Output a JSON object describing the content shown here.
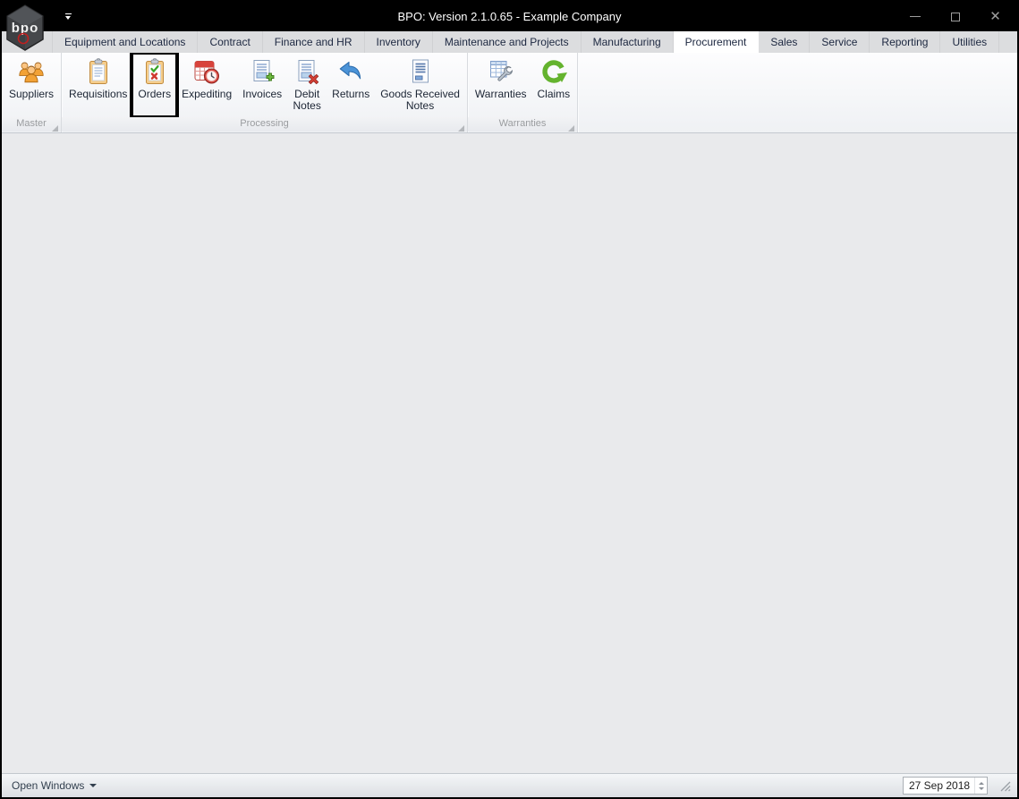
{
  "window": {
    "title": "BPO: Version 2.1.0.65 - Example Company",
    "logo_text": "bpo"
  },
  "tabs": [
    {
      "label": "Equipment and Locations",
      "active": false
    },
    {
      "label": "Contract",
      "active": false
    },
    {
      "label": "Finance and HR",
      "active": false
    },
    {
      "label": "Inventory",
      "active": false
    },
    {
      "label": "Maintenance and Projects",
      "active": false
    },
    {
      "label": "Manufacturing",
      "active": false
    },
    {
      "label": "Procurement",
      "active": true
    },
    {
      "label": "Sales",
      "active": false
    },
    {
      "label": "Service",
      "active": false
    },
    {
      "label": "Reporting",
      "active": false
    },
    {
      "label": "Utilities",
      "active": false
    }
  ],
  "ribbon": {
    "groups": [
      {
        "caption": "Master",
        "buttons": [
          {
            "label": "Suppliers",
            "icon": "suppliers-icon",
            "highlighted": false
          }
        ]
      },
      {
        "caption": "Processing",
        "buttons": [
          {
            "label": "Requisitions",
            "icon": "requisitions-icon",
            "highlighted": false
          },
          {
            "label": "Orders",
            "icon": "orders-icon",
            "highlighted": true
          },
          {
            "label": "Expediting",
            "icon": "expediting-icon",
            "highlighted": false
          },
          {
            "label": "Invoices",
            "icon": "invoices-icon",
            "highlighted": false
          },
          {
            "label": "Debit\nNotes",
            "icon": "debit-notes-icon",
            "highlighted": false
          },
          {
            "label": "Returns",
            "icon": "returns-icon",
            "highlighted": false
          },
          {
            "label": "Goods Received\nNotes",
            "icon": "goods-received-notes-icon",
            "highlighted": false
          }
        ]
      },
      {
        "caption": "Warranties",
        "buttons": [
          {
            "label": "Warranties",
            "icon": "warranties-icon",
            "highlighted": false
          },
          {
            "label": "Claims",
            "icon": "claims-icon",
            "highlighted": false
          }
        ]
      }
    ]
  },
  "statusbar": {
    "open_windows_label": "Open Windows",
    "date_value": "27 Sep 2018"
  },
  "colors": {
    "titlebar_bg": "#000000",
    "tabstrip_bg": "#dcdddf",
    "active_tab_bg": "#ffffff",
    "content_bg": "#e9eaec",
    "highlight_box": "#000000"
  }
}
